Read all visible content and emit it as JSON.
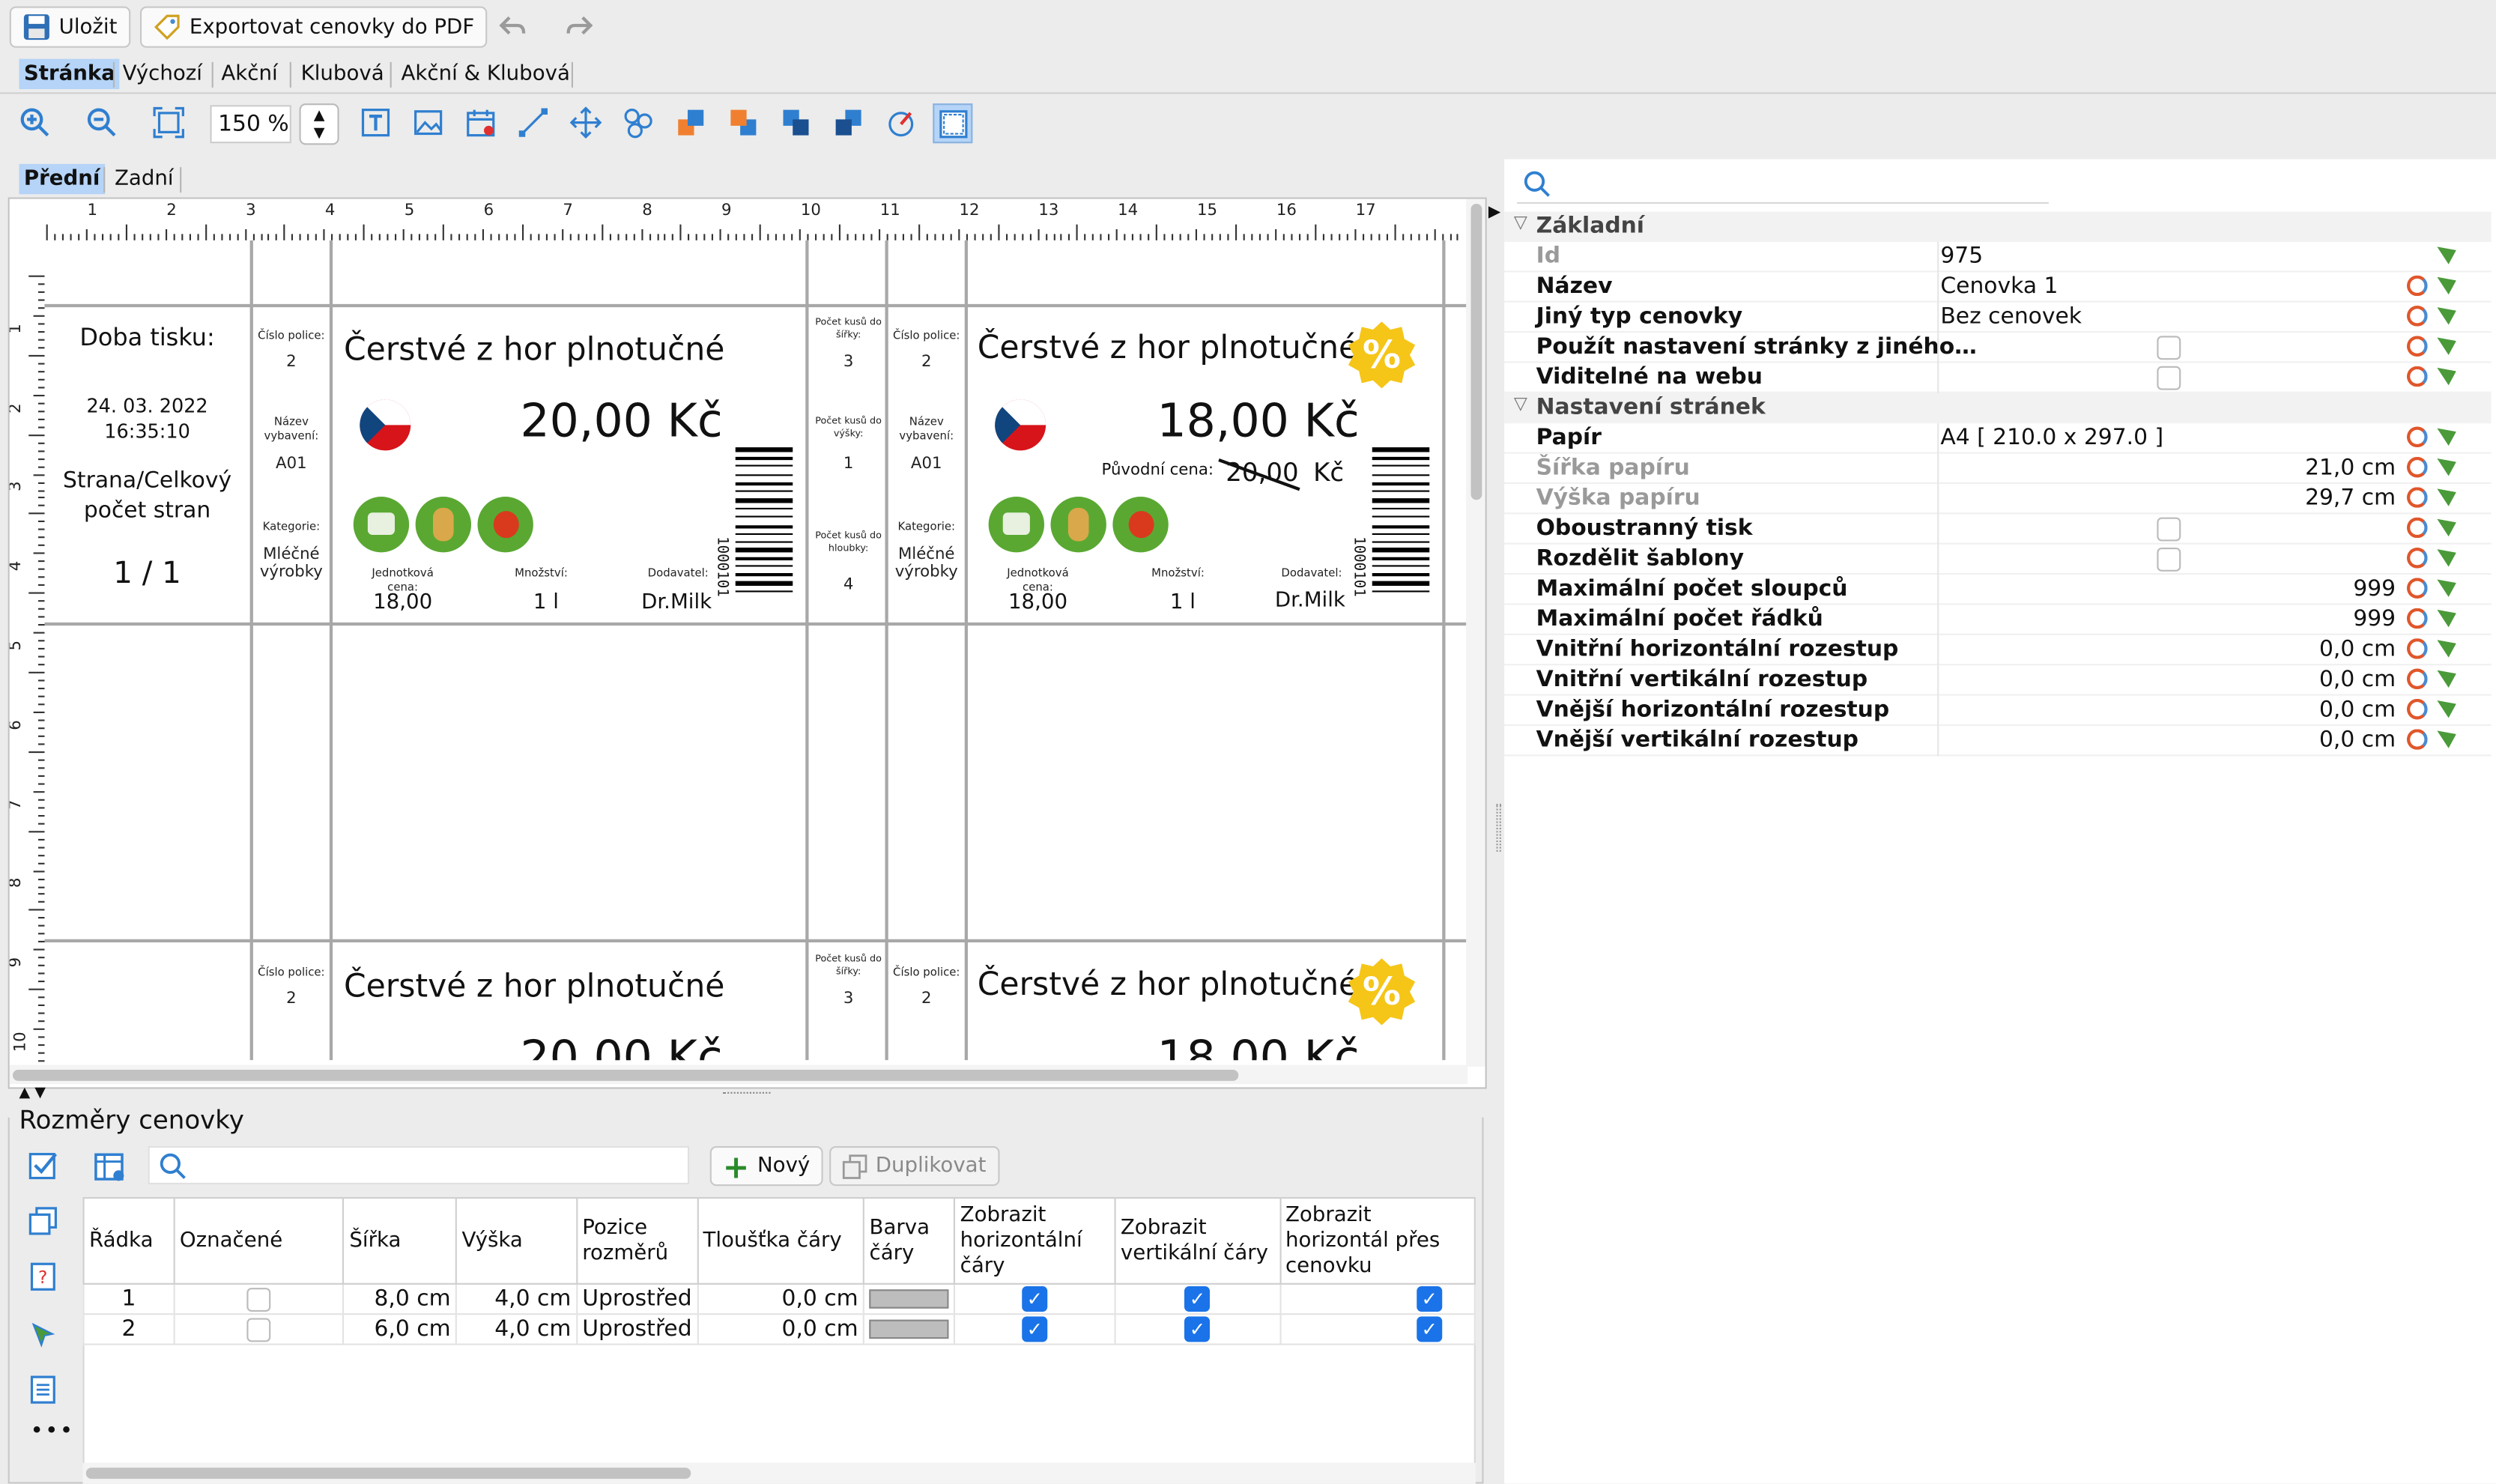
{
  "toolbar": {
    "save_label": "Uložit",
    "export_label": "Exportovat cenovky do PDF"
  },
  "mode_tabs": [
    "Stránka",
    "Výchozí",
    "Akční",
    "Klubová",
    "Akční & Klubová"
  ],
  "zoom": {
    "value": "150 %"
  },
  "side_tabs": [
    "Přední",
    "Zadní"
  ],
  "ruler": {
    "h": [
      "1",
      "2",
      "3",
      "4",
      "5",
      "6",
      "7",
      "8",
      "9",
      "10",
      "11",
      "12",
      "13",
      "14",
      "15",
      "16",
      "17"
    ],
    "v": [
      "1",
      "2",
      "3",
      "4",
      "5",
      "6",
      "7",
      "8",
      "9",
      "10"
    ]
  },
  "header_cell": {
    "print_time_label": "Doba tisku:",
    "date": "24. 03. 2022",
    "time": "16:35:10",
    "page_label": "Strana/Celkový počet stran",
    "page_value": "1 / 1"
  },
  "tags": [
    {
      "shelf_label": "Číslo police:",
      "shelf_value": "2",
      "code_label": "Název vybavení:",
      "code_value": "A01",
      "category_label": "Kategorie:",
      "category_value": "Mléčné výrobky",
      "title": "Čerstvé z hor plnotučné",
      "price": "20,00 Kč",
      "old_price_label": "",
      "old_price": "",
      "old_currency": "",
      "unit_label": "Jednotková cena:",
      "unit_value": "18,00",
      "qty_label": "Množství:",
      "qty_value": "1 l",
      "supplier_label": "Dodavatel:",
      "supplier_value": "Dr.Milk",
      "barcode": "1000101",
      "width_label": "Počet kusů do šířky:",
      "width_value": "3",
      "height_label": "Počet kusů do výšky:",
      "height_value": "1",
      "depth_label": "Počet kusů do hloubky:",
      "depth_value": "4",
      "promo": false
    },
    {
      "shelf_label": "Číslo police:",
      "shelf_value": "2",
      "code_label": "Název vybavení:",
      "code_value": "A01",
      "category_label": "Kategorie:",
      "category_value": "Mléčné výrobky",
      "title": "Čerstvé z hor plnotučné",
      "price": "18,00 Kč",
      "old_price_label": "Původní cena:",
      "old_price": "20,00",
      "old_currency": "Kč",
      "unit_label": "Jednotková cena:",
      "unit_value": "18,00",
      "qty_label": "Množství:",
      "qty_value": "1 l",
      "supplier_label": "Dodavatel:",
      "supplier_value": "Dr.Milk",
      "barcode": "1000101",
      "promo": true,
      "promo_symbol": "%"
    }
  ],
  "props": {
    "search_placeholder": "",
    "sections": [
      {
        "title": "Základní",
        "rows": [
          {
            "key": "Id",
            "value": "975",
            "grey": true
          },
          {
            "key": "Název",
            "value": "Cenovka 1"
          },
          {
            "key": "Jiný typ cenovky",
            "value": "Bez cenovek"
          },
          {
            "key": "Použít nastavení stránky z jiného…",
            "value": "",
            "check": true
          },
          {
            "key": "Viditelné na webu",
            "value": "",
            "check": true
          }
        ]
      },
      {
        "title": "Nastavení stránek",
        "rows": [
          {
            "key": "Papír",
            "value": "A4 [ 210.0 x 297.0 ]"
          },
          {
            "key": "Šířka papíru",
            "value": "21,0 cm",
            "grey": true,
            "right": true
          },
          {
            "key": "Výška papíru",
            "value": "29,7 cm",
            "grey": true,
            "right": true
          },
          {
            "key": "Oboustranný tisk",
            "value": "",
            "check": true
          },
          {
            "key": "Rozdělit šablony",
            "value": "",
            "check": true
          },
          {
            "key": "Maximální počet sloupců",
            "value": "999",
            "right": true
          },
          {
            "key": "Maximální počet řádků",
            "value": "999",
            "right": true
          },
          {
            "key": "Vnitřní horizontální rozestup",
            "value": "0,0 cm",
            "right": true
          },
          {
            "key": "Vnitřní vertikální rozestup",
            "value": "0,0 cm",
            "right": true
          },
          {
            "key": "Vnější horizontální rozestup",
            "value": "0,0 cm",
            "right": true
          },
          {
            "key": "Vnější vertikální rozestup",
            "value": "0,0 cm",
            "right": true
          }
        ]
      }
    ]
  },
  "sizes": {
    "title": "Rozměry cenovky",
    "new_label": "Nový",
    "duplicate_label": "Duplikovat",
    "columns": [
      "Řádka",
      "Označené",
      "Šířka",
      "Výška",
      "Pozice rozměrů",
      "Tloušťka čáry",
      "Barva čáry",
      "Zobrazit horizontální čáry",
      "Zobrazit vertikální čáry",
      "Zobrazit horizontál přes cenovku"
    ],
    "rows": [
      {
        "row": "1",
        "width": "8,0 cm",
        "height": "4,0 cm",
        "position": "Uprostřed",
        "thickness": "0,0 cm"
      },
      {
        "row": "2",
        "width": "6,0 cm",
        "height": "4,0 cm",
        "position": "Uprostřed",
        "thickness": "0,0 cm"
      }
    ]
  },
  "colors": {
    "accent": "#1a73e8",
    "promo": "#f5c518",
    "selected_tab": "#b5d4f7"
  }
}
